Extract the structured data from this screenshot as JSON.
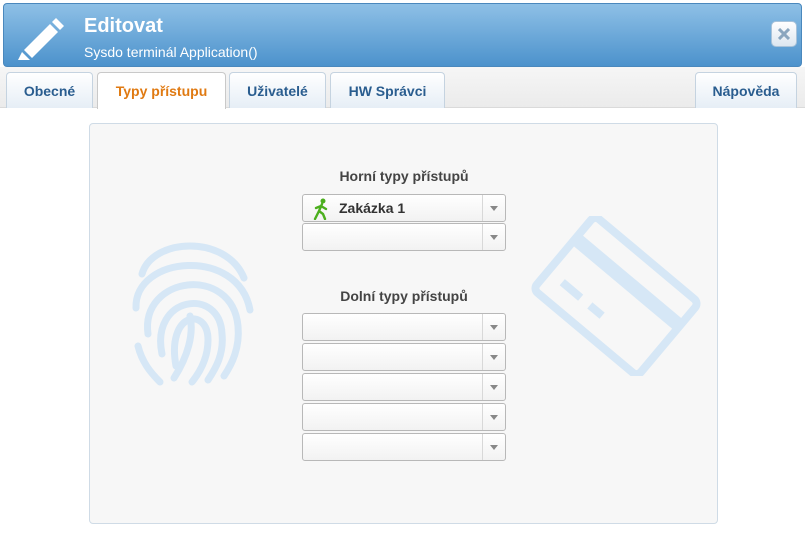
{
  "header": {
    "title": "Editovat",
    "subtitle": "Sysdo terminál Application()",
    "icon": "pencil-icon",
    "close_icon": "close-icon"
  },
  "tabs": [
    {
      "label": "Obecné",
      "active": false
    },
    {
      "label": "Typy přístupu",
      "active": true
    },
    {
      "label": "Uživatelé",
      "active": false
    },
    {
      "label": "HW Správci",
      "active": false
    }
  ],
  "help_tab": {
    "label": "Nápověda"
  },
  "upper": {
    "title": "Horní typy přístupů",
    "selects": [
      {
        "value": "Zakázka 1",
        "icon": "walking-person-icon"
      },
      {
        "value": ""
      }
    ]
  },
  "lower": {
    "title": "Dolní typy přístupů",
    "selects": [
      {
        "value": ""
      },
      {
        "value": ""
      },
      {
        "value": ""
      },
      {
        "value": ""
      },
      {
        "value": ""
      }
    ]
  },
  "colors": {
    "header": "#5a9fd6",
    "tab_text": "#2a5d8f",
    "active_tab_text": "#e07a12",
    "watermark": "#d9e9f7",
    "walk_icon": "#4caf1e"
  },
  "decorations": [
    "fingerprint-icon",
    "card-icon"
  ]
}
